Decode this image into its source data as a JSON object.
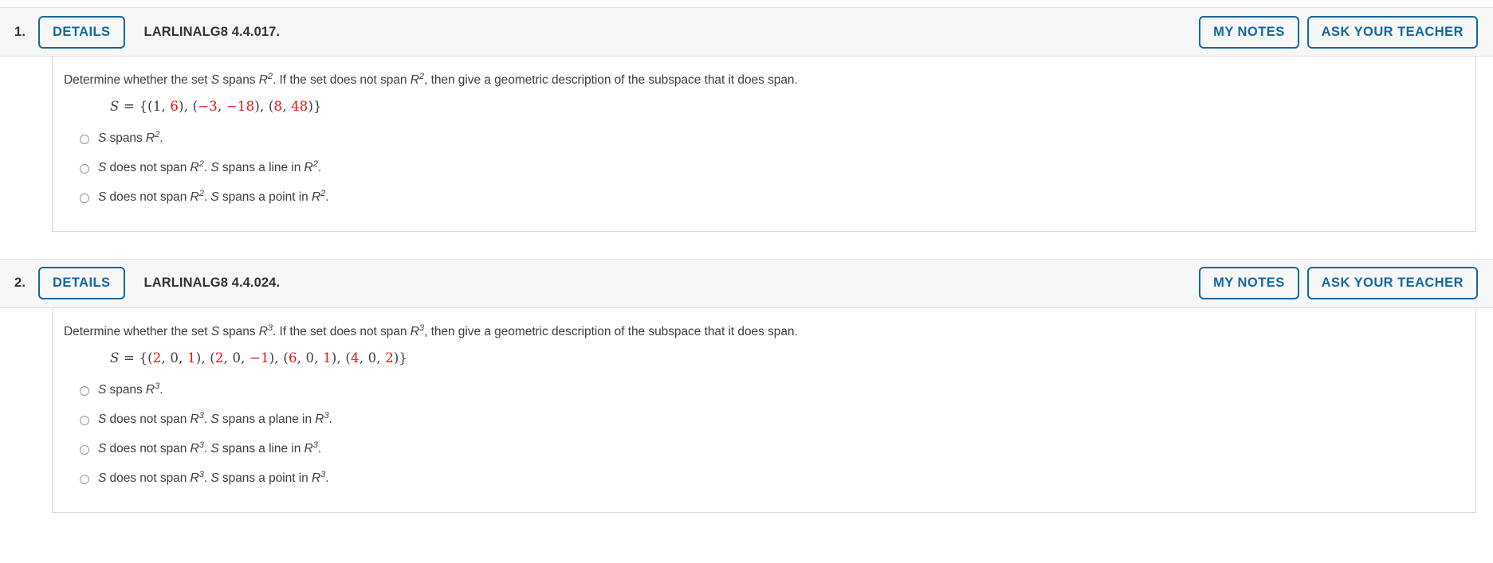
{
  "buttons": {
    "details_label": "DETAILS",
    "my_notes_label": "MY NOTES",
    "ask_your_teacher_label": "ASK YOUR TEACHER"
  },
  "colors": {
    "accent_blue": "#1268a3",
    "header_background": "#f7f7f7",
    "value_red": "#e8140f",
    "text": "#3c4043",
    "border": "#d9d9d9"
  },
  "questions": [
    {
      "number": "1.",
      "title": "LARLINALG8 4.4.017.",
      "prompt_parts": {
        "p1": "Determine whether the set ",
        "var_s": "S",
        "p2": " spans ",
        "space_base": "R",
        "space_exp": "2",
        "p3": ". If the set does not span ",
        "p4": ", then give a geometric description of the subspace that it does span."
      },
      "set_label": "S",
      "set_equals": "=",
      "set_vectors": [
        [
          {
            "t": "1",
            "c": "black"
          },
          {
            "t": "6",
            "c": "red"
          }
        ],
        [
          {
            "t": "−3",
            "c": "red"
          },
          {
            "t": "−18",
            "c": "red"
          }
        ],
        [
          {
            "t": "8",
            "c": "red"
          },
          {
            "t": "48",
            "c": "red"
          }
        ]
      ],
      "options": [
        {
          "segments": [
            {
              "t": "S",
              "style": "italic"
            },
            {
              "t": " spans ",
              "style": "normal"
            },
            {
              "t": "R",
              "style": "italic"
            },
            {
              "t": "2",
              "style": "sup"
            },
            {
              "t": ".",
              "style": "normal"
            }
          ]
        },
        {
          "segments": [
            {
              "t": "S",
              "style": "italic"
            },
            {
              "t": " does not span ",
              "style": "normal"
            },
            {
              "t": "R",
              "style": "italic"
            },
            {
              "t": "2",
              "style": "sup"
            },
            {
              "t": ". ",
              "style": "normal"
            },
            {
              "t": "S",
              "style": "italic"
            },
            {
              "t": " spans a line in ",
              "style": "normal"
            },
            {
              "t": "R",
              "style": "italic"
            },
            {
              "t": "2",
              "style": "sup"
            },
            {
              "t": ".",
              "style": "normal"
            }
          ]
        },
        {
          "segments": [
            {
              "t": "S",
              "style": "italic"
            },
            {
              "t": " does not span ",
              "style": "normal"
            },
            {
              "t": "R",
              "style": "italic"
            },
            {
              "t": "2",
              "style": "sup"
            },
            {
              "t": ". ",
              "style": "normal"
            },
            {
              "t": "S",
              "style": "italic"
            },
            {
              "t": " spans a point in ",
              "style": "normal"
            },
            {
              "t": "R",
              "style": "italic"
            },
            {
              "t": "2",
              "style": "sup"
            },
            {
              "t": ".",
              "style": "normal"
            }
          ]
        }
      ]
    },
    {
      "number": "2.",
      "title": "LARLINALG8 4.4.024.",
      "prompt_parts": {
        "p1": "Determine whether the set ",
        "var_s": "S",
        "p2": " spans ",
        "space_base": "R",
        "space_exp": "3",
        "p3": ". If the set does not span ",
        "p4": ", then give a geometric description of the subspace that it does span."
      },
      "set_label": "S",
      "set_equals": "=",
      "set_vectors": [
        [
          {
            "t": "2",
            "c": "red"
          },
          {
            "t": "0",
            "c": "black"
          },
          {
            "t": "1",
            "c": "red"
          }
        ],
        [
          {
            "t": "2",
            "c": "red"
          },
          {
            "t": "0",
            "c": "black"
          },
          {
            "t": "−1",
            "c": "red"
          }
        ],
        [
          {
            "t": "6",
            "c": "red"
          },
          {
            "t": "0",
            "c": "black"
          },
          {
            "t": "1",
            "c": "red"
          }
        ],
        [
          {
            "t": "4",
            "c": "red"
          },
          {
            "t": "0",
            "c": "black"
          },
          {
            "t": "2",
            "c": "red"
          }
        ]
      ],
      "options": [
        {
          "segments": [
            {
              "t": "S",
              "style": "italic"
            },
            {
              "t": " spans ",
              "style": "normal"
            },
            {
              "t": "R",
              "style": "italic"
            },
            {
              "t": "3",
              "style": "sup"
            },
            {
              "t": ".",
              "style": "normal"
            }
          ]
        },
        {
          "segments": [
            {
              "t": "S",
              "style": "italic"
            },
            {
              "t": " does not span ",
              "style": "normal"
            },
            {
              "t": "R",
              "style": "italic"
            },
            {
              "t": "3",
              "style": "sup"
            },
            {
              "t": ". ",
              "style": "normal"
            },
            {
              "t": "S",
              "style": "italic"
            },
            {
              "t": " spans a plane in ",
              "style": "normal"
            },
            {
              "t": "R",
              "style": "italic"
            },
            {
              "t": "3",
              "style": "sup"
            },
            {
              "t": ".",
              "style": "normal"
            }
          ]
        },
        {
          "segments": [
            {
              "t": "S",
              "style": "italic"
            },
            {
              "t": " does not span ",
              "style": "normal"
            },
            {
              "t": "R",
              "style": "italic"
            },
            {
              "t": "3",
              "style": "sup"
            },
            {
              "t": ". ",
              "style": "normal"
            },
            {
              "t": "S",
              "style": "italic"
            },
            {
              "t": " spans a line in ",
              "style": "normal"
            },
            {
              "t": "R",
              "style": "italic"
            },
            {
              "t": "3",
              "style": "sup"
            },
            {
              "t": ".",
              "style": "normal"
            }
          ]
        },
        {
          "segments": [
            {
              "t": "S",
              "style": "italic"
            },
            {
              "t": " does not span ",
              "style": "normal"
            },
            {
              "t": "R",
              "style": "italic"
            },
            {
              "t": "3",
              "style": "sup"
            },
            {
              "t": ". ",
              "style": "normal"
            },
            {
              "t": "S",
              "style": "italic"
            },
            {
              "t": " spans a point in ",
              "style": "normal"
            },
            {
              "t": "R",
              "style": "italic"
            },
            {
              "t": "3",
              "style": "sup"
            },
            {
              "t": ".",
              "style": "normal"
            }
          ]
        }
      ]
    }
  ]
}
